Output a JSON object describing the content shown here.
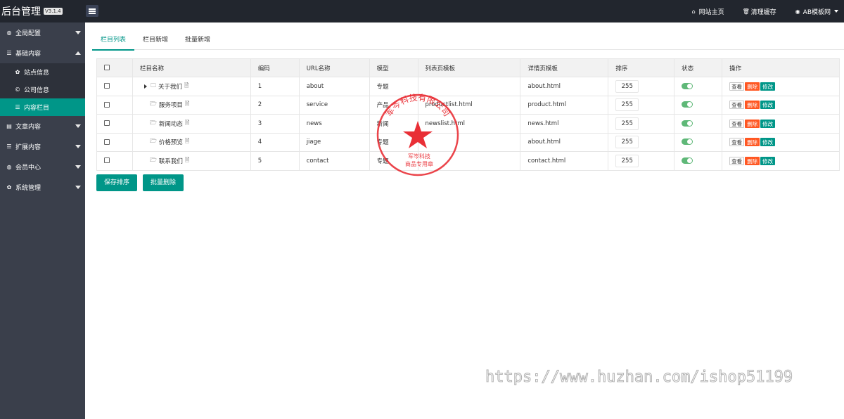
{
  "header": {
    "logo_text": "后台管理",
    "version": "V3.1.4",
    "home_link": "网站主页",
    "clear_cache": "清理缓存",
    "user": "AB模板网"
  },
  "sidebar": {
    "items": [
      {
        "label": "全局配置",
        "icon": "globe-icon"
      },
      {
        "label": "基础内容",
        "icon": "sliders-icon",
        "expanded": true,
        "children": [
          {
            "label": "站点信息",
            "icon": "gear-icon"
          },
          {
            "label": "公司信息",
            "icon": "copyright-icon"
          },
          {
            "label": "内容栏目",
            "icon": "list-icon",
            "active": true
          }
        ]
      },
      {
        "label": "文章内容",
        "icon": "file-icon"
      },
      {
        "label": "扩展内容",
        "icon": "sliders-icon"
      },
      {
        "label": "会员中心",
        "icon": "user-icon"
      },
      {
        "label": "系统管理",
        "icon": "gear-icon"
      }
    ]
  },
  "tabs": [
    "栏目列表",
    "栏目新增",
    "批量新增"
  ],
  "table": {
    "headers": [
      "栏目名称",
      "编码",
      "URL名称",
      "模型",
      "列表页模板",
      "详情页模板",
      "排序",
      "状态",
      "操作"
    ],
    "rows": [
      {
        "name": "关于我们",
        "code": "1",
        "url": "about",
        "model": "专题",
        "list_tpl": "",
        "detail_tpl": "about.html",
        "sort": "255",
        "status": "on",
        "expand": true
      },
      {
        "name": "服务项目",
        "code": "2",
        "url": "service",
        "model": "产品",
        "list_tpl": "productlist.html",
        "detail_tpl": "product.html",
        "sort": "255",
        "status": "on"
      },
      {
        "name": "新闻动态",
        "code": "3",
        "url": "news",
        "model": "新闻",
        "list_tpl": "newslist.html",
        "detail_tpl": "news.html",
        "sort": "255",
        "status": "on"
      },
      {
        "name": "价格预览",
        "code": "4",
        "url": "jiage",
        "model": "专题",
        "list_tpl": "",
        "detail_tpl": "about.html",
        "sort": "255",
        "status": "on"
      },
      {
        "name": "联系我们",
        "code": "5",
        "url": "contact",
        "model": "专题",
        "list_tpl": "",
        "detail_tpl": "contact.html",
        "sort": "255",
        "status": "on"
      }
    ],
    "row_actions": {
      "view": "查看",
      "delete": "删除",
      "edit": "修改"
    }
  },
  "buttons": {
    "save_sort": "保存排序",
    "batch_delete": "批量删除"
  },
  "stamp": {
    "company": "军岑科技有限公司",
    "line1": "军岑科技",
    "line2": "商品专用章",
    "color": "#e8242b"
  },
  "watermark": "https://www.huzhan.com/ishop51199",
  "colors": {
    "accent": "#009688",
    "danger": "#ff5722",
    "switch": "#5fb878",
    "header": "#22262e",
    "sidebar": "#3a3f4b"
  }
}
